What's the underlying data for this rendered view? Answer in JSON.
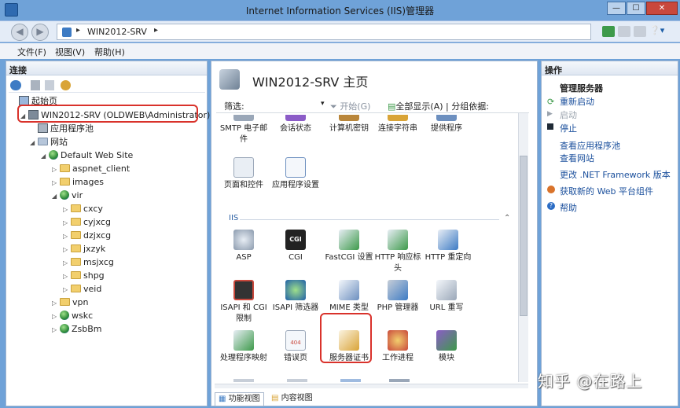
{
  "window": {
    "title": "Internet Information Services (IIS)管理器",
    "minimize_glyph": "—",
    "maximize_glyph": "☐",
    "close_glyph": "✕"
  },
  "address": {
    "separator": "▸",
    "path": "WIN2012-SRV",
    "trailing": "▸",
    "back_glyph": "◀",
    "forward_glyph": "▶",
    "help_glyph": "❔▾"
  },
  "menu": {
    "file": "文件(F)",
    "view": "视图(V)",
    "help": "帮助(H)"
  },
  "connections": {
    "header": "连接",
    "tree": [
      {
        "label": "起始页"
      },
      {
        "label": "WIN2012-SRV (OLDWEB\\Administrator)"
      },
      {
        "label": "应用程序池"
      },
      {
        "label": "网站"
      },
      {
        "label": "Default Web Site"
      },
      {
        "label": "aspnet_client"
      },
      {
        "label": "images"
      },
      {
        "label": "vir"
      },
      {
        "label": "cxcy"
      },
      {
        "label": "cyjxcg"
      },
      {
        "label": "dzjxcg"
      },
      {
        "label": "jxzyk"
      },
      {
        "label": "msjxcg"
      },
      {
        "label": "shpg"
      },
      {
        "label": "veid"
      },
      {
        "label": "vpn"
      },
      {
        "label": "wskc"
      },
      {
        "label": "ZsbBm"
      }
    ]
  },
  "main": {
    "title": "WIN2012-SRV 主页",
    "filter_label": "筛选:",
    "start_label": "开始(G)",
    "show_all_label": "全部显示(A)",
    "group_label": "分组依据:",
    "section_iis": "IIS",
    "collapse_glyph": "⌃",
    "row1": [
      {
        "label": "SMTP 电子邮件"
      },
      {
        "label": "会话状态"
      },
      {
        "label": "计算机密钥"
      },
      {
        "label": "连接字符串"
      },
      {
        "label": "提供程序"
      }
    ],
    "row2": [
      {
        "label": "页面和控件"
      },
      {
        "label": "应用程序设置"
      }
    ],
    "row3": [
      {
        "label": "ASP",
        "icon": "asp-icon"
      },
      {
        "label": "CGI",
        "icon": "cgi-icon",
        "badge": "CGI"
      },
      {
        "label": "FastCGI 设置",
        "icon": "fastcgi-icon"
      },
      {
        "label": "HTTP 响应标头",
        "icon": "http-headers-icon"
      },
      {
        "label": "HTTP 重定向",
        "icon": "http-redirect-icon"
      }
    ],
    "row4": [
      {
        "label": "ISAPI 和 CGI 限制"
      },
      {
        "label": "ISAPI 筛选器"
      },
      {
        "label": "MIME 类型"
      },
      {
        "label": "PHP 管理器"
      },
      {
        "label": "URL 重写"
      }
    ],
    "row5": [
      {
        "label": "处理程序映射"
      },
      {
        "label": "错误页",
        "badge": "404"
      },
      {
        "label": "服务器证书"
      },
      {
        "label": "工作进程"
      },
      {
        "label": "模块"
      }
    ],
    "tab_features": "功能视图",
    "tab_content": "内容视图"
  },
  "actions": {
    "header": "操作",
    "manage_server": "管理服务器",
    "restart": "重新启动",
    "start": "启动",
    "stop": "停止",
    "view_app_pools": "查看应用程序池",
    "view_sites": "查看网站",
    "change_framework": "更改 .NET Framework 版本",
    "get_platform": "获取新的 Web 平台组件",
    "help": "帮助"
  },
  "watermark": "知乎 @在路上",
  "colors": {
    "titlebar": "#6fa2d8",
    "highlight": "#d9322b",
    "link": "#1a4f9c"
  }
}
